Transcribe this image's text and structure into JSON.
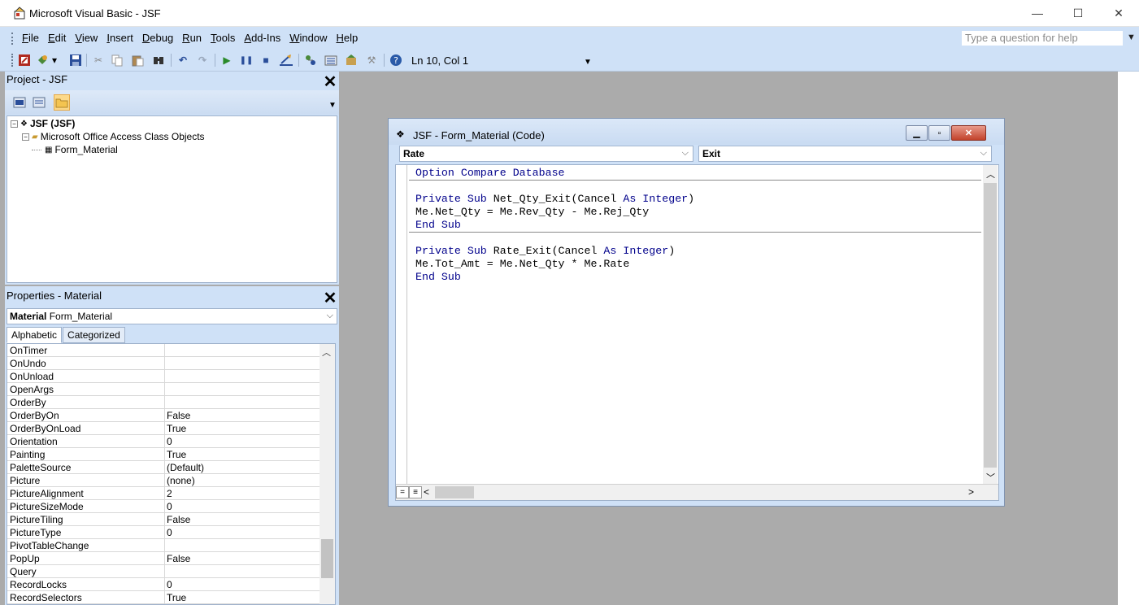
{
  "window": {
    "title": "Microsoft Visual Basic - JSF",
    "minimize": "—",
    "maximize": "☐",
    "close": "✕"
  },
  "menubar": {
    "items": [
      {
        "hot": "F",
        "rest": "ile"
      },
      {
        "hot": "E",
        "rest": "dit"
      },
      {
        "hot": "V",
        "rest": "iew"
      },
      {
        "hot": "I",
        "rest": "nsert"
      },
      {
        "hot": "D",
        "rest": "ebug"
      },
      {
        "hot": "R",
        "rest": "un"
      },
      {
        "hot": "T",
        "rest": "ools"
      },
      {
        "hot": "A",
        "rest": "dd-Ins"
      },
      {
        "hot": "W",
        "rest": "indow"
      },
      {
        "hot": "H",
        "rest": "elp"
      }
    ],
    "help_placeholder": "Type a question for help"
  },
  "toolbar": {
    "position": "Ln 10, Col 1",
    "icons": [
      "access-icon",
      "insert-module-icon",
      "save-icon",
      "cut-icon",
      "copy-icon",
      "paste-icon",
      "find-icon",
      "undo-icon",
      "redo-icon",
      "run-icon",
      "break-icon",
      "reset-icon",
      "design-mode-icon",
      "project-explorer-icon",
      "properties-icon",
      "object-browser-icon",
      "toolbox-icon",
      "help-icon"
    ]
  },
  "project_pane": {
    "title": "Project - JSF",
    "tree": [
      {
        "label": "JSF (JSF)",
        "bold": true,
        "expander": "−",
        "icon": "vba-project-icon"
      },
      {
        "label": "Microsoft Office Access Class Objects",
        "bold": false,
        "expander": "−",
        "icon": "folder-icon"
      },
      {
        "label": "Form_Material",
        "bold": false,
        "expander": "",
        "icon": "form-icon"
      }
    ]
  },
  "props_pane": {
    "title": "Properties - Material",
    "object_bold": "Material",
    "object_rest": " Form_Material",
    "tabs": [
      "Alphabetic",
      "Categorized"
    ],
    "rows": [
      {
        "name": "OnTimer",
        "value": ""
      },
      {
        "name": "OnUndo",
        "value": ""
      },
      {
        "name": "OnUnload",
        "value": ""
      },
      {
        "name": "OpenArgs",
        "value": ""
      },
      {
        "name": "OrderBy",
        "value": ""
      },
      {
        "name": "OrderByOn",
        "value": "False"
      },
      {
        "name": "OrderByOnLoad",
        "value": "True"
      },
      {
        "name": "Orientation",
        "value": "0"
      },
      {
        "name": "Painting",
        "value": "True"
      },
      {
        "name": "PaletteSource",
        "value": "(Default)"
      },
      {
        "name": "Picture",
        "value": "(none)"
      },
      {
        "name": "PictureAlignment",
        "value": "2"
      },
      {
        "name": "PictureSizeMode",
        "value": "0"
      },
      {
        "name": "PictureTiling",
        "value": "False"
      },
      {
        "name": "PictureType",
        "value": "0"
      },
      {
        "name": "PivotTableChange",
        "value": ""
      },
      {
        "name": "PopUp",
        "value": "False"
      },
      {
        "name": "Query",
        "value": ""
      },
      {
        "name": "RecordLocks",
        "value": "0"
      },
      {
        "name": "RecordSelectors",
        "value": "True"
      }
    ]
  },
  "code_window": {
    "title": "JSF - Form_Material (Code)",
    "object_combo": "Rate",
    "proc_combo": "Exit",
    "lines": [
      [
        {
          "t": "Option Compare Database",
          "k": true
        }
      ],
      [],
      [
        {
          "t": "Private Sub",
          "k": true
        },
        {
          "t": " Net_Qty_Exit(Cancel ",
          "k": false
        },
        {
          "t": "As Integer",
          "k": true
        },
        {
          "t": ")",
          "k": false
        }
      ],
      [
        {
          "t": "Me.Net_Qty = Me.Rev_Qty - Me.Rej_Qty",
          "k": false
        }
      ],
      [
        {
          "t": "End Sub",
          "k": true
        }
      ],
      [],
      [
        {
          "t": "Private Sub",
          "k": true
        },
        {
          "t": " Rate_Exit(Cancel ",
          "k": false
        },
        {
          "t": "As Integer",
          "k": true
        },
        {
          "t": ")",
          "k": false
        }
      ],
      [
        {
          "t": "Me.Tot_Amt = Me.Net_Qty * Me.Rate",
          "k": false
        }
      ],
      [
        {
          "t": "End Sub",
          "k": true
        }
      ]
    ]
  },
  "colors": {
    "chrome": "#cfe1f7",
    "mdi_background": "#ababab",
    "keyword": "#00008b"
  }
}
